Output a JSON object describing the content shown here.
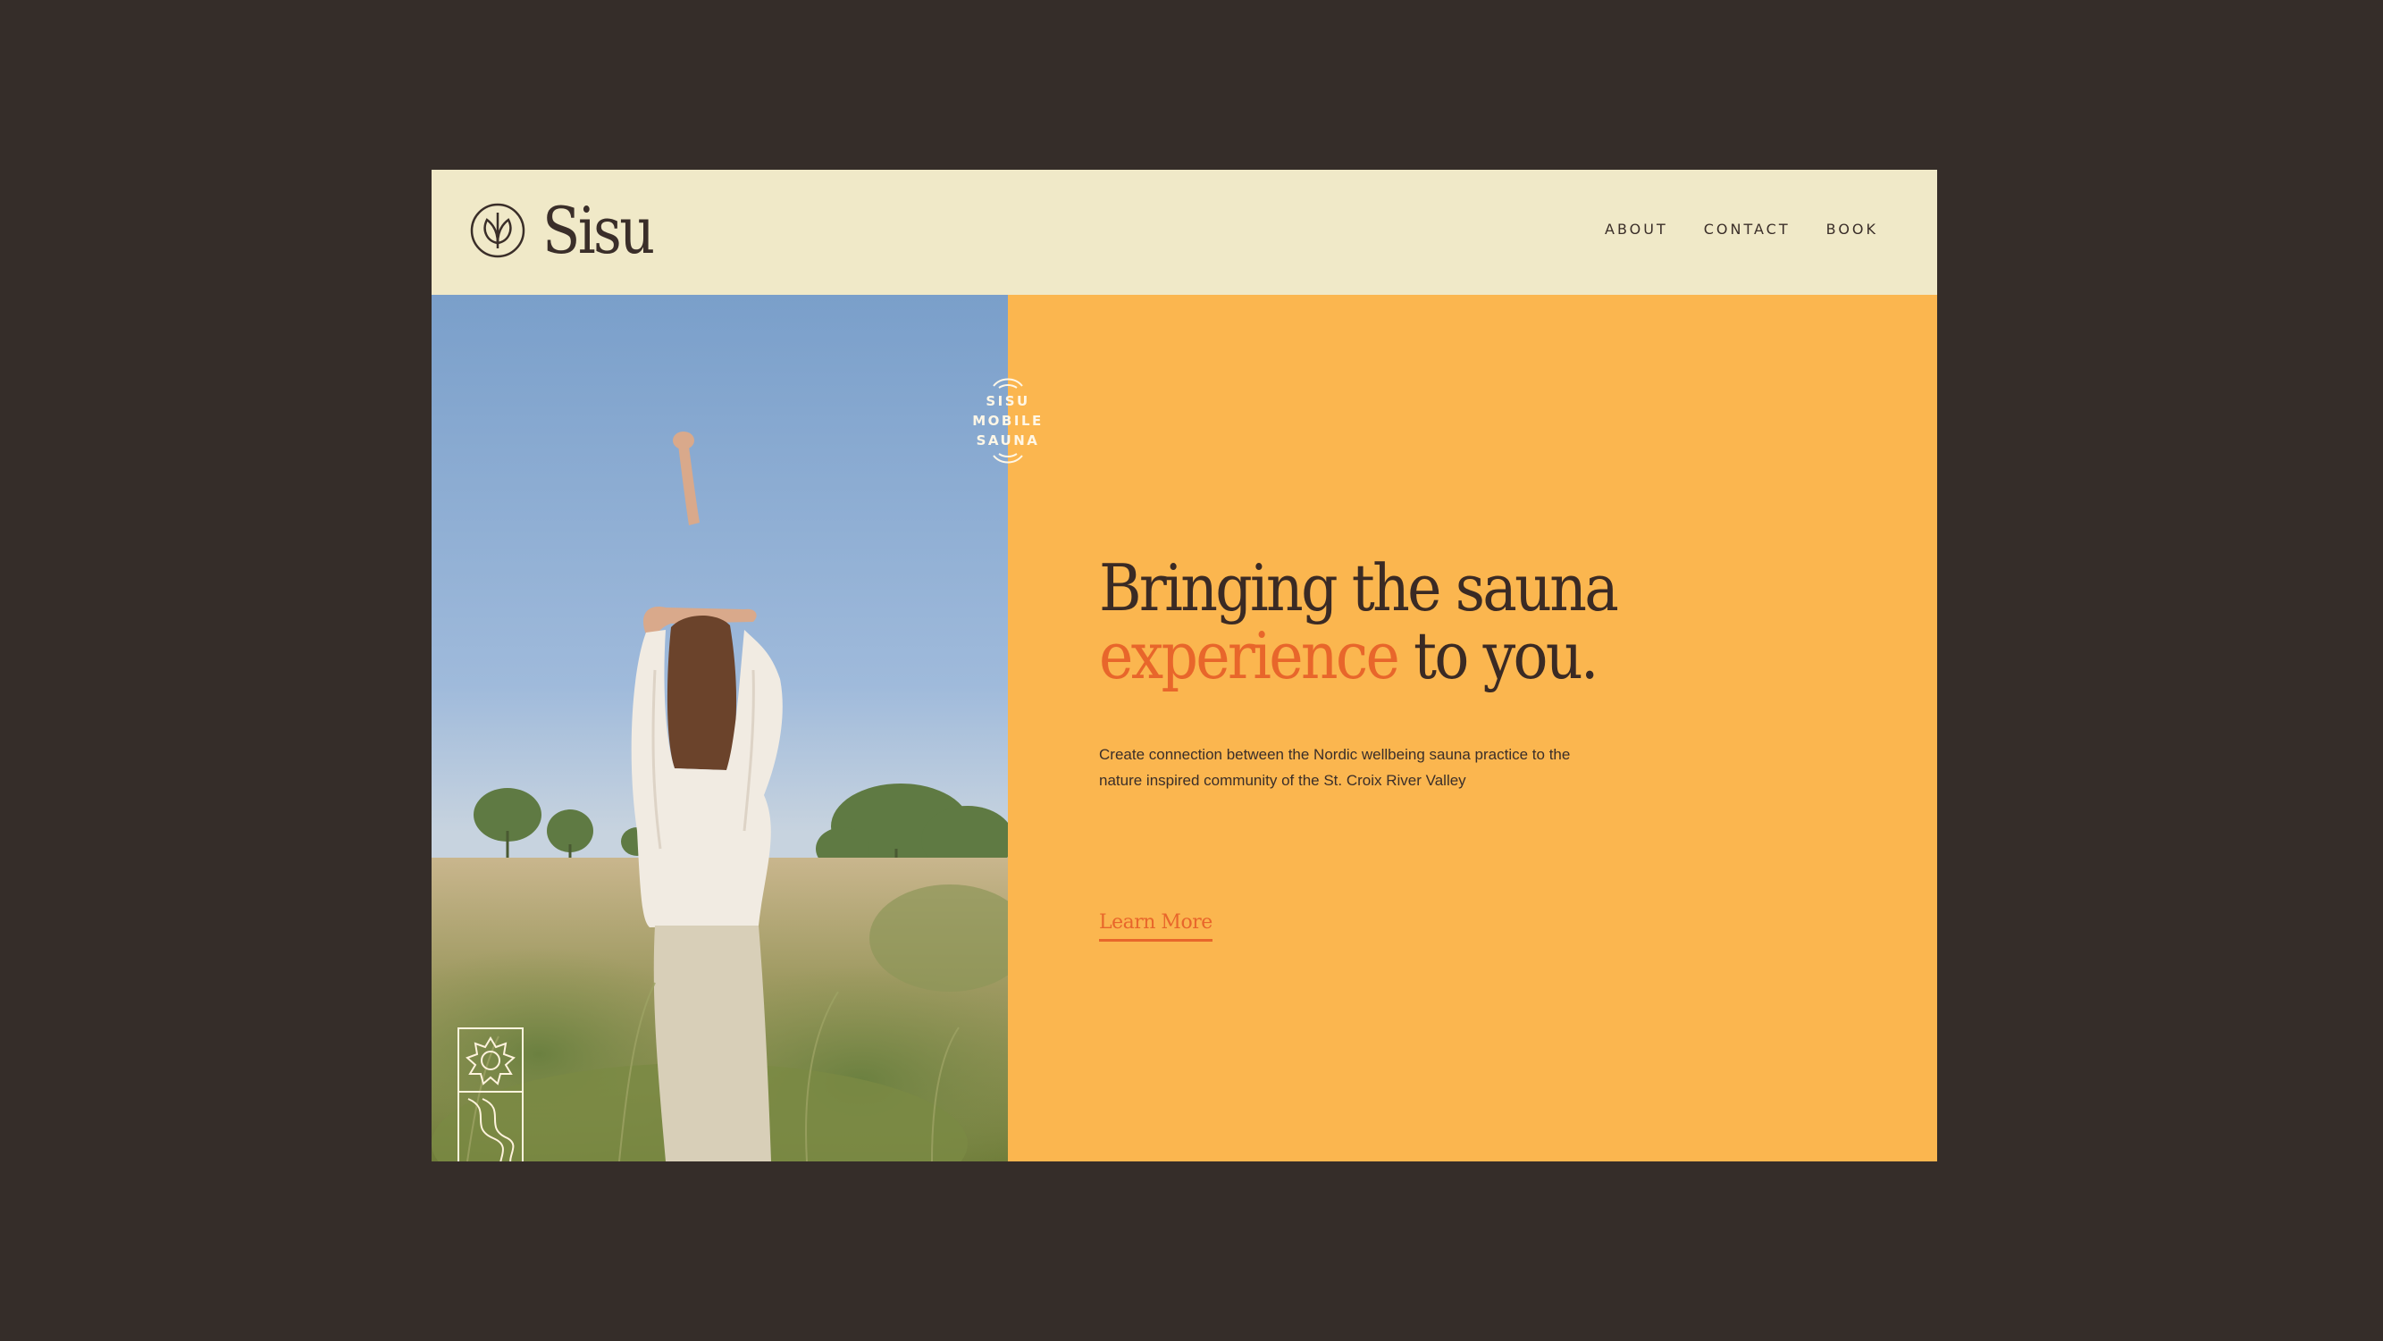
{
  "header": {
    "brand": "Sisu",
    "nav": [
      "ABOUT",
      "CONTACT",
      "BOOK"
    ]
  },
  "badge": {
    "lines": [
      "SISU",
      "MOBILE",
      "SAUNA"
    ]
  },
  "hero": {
    "headline_line1": "Bringing the sauna",
    "headline_accent": "experience",
    "headline_line2_end": " to you.",
    "description": "Create connection between the Nordic wellbeing sauna practice to the nature inspired community of the St. Croix River Valley",
    "cta": "Learn More"
  },
  "photo_credit": "",
  "colors": {
    "background": "#352d29",
    "header": "#f0e9c8",
    "hero": "#fbb64f",
    "accent": "#e8662b",
    "text": "#3a2a24"
  },
  "icons": {
    "logo": "leaf-circle-icon",
    "emblem": "sun-wave-moon-icon"
  }
}
